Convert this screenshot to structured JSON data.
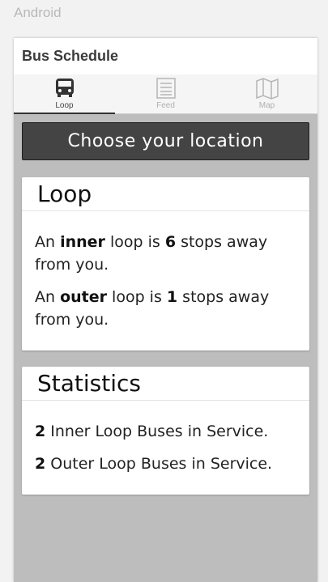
{
  "system": {
    "label": "Android"
  },
  "header": {
    "title": "Bus Schedule"
  },
  "tabs": [
    {
      "label": "Loop",
      "icon": "bus-icon",
      "active": true
    },
    {
      "label": "Feed",
      "icon": "list-icon",
      "active": false
    },
    {
      "label": "Map",
      "icon": "map-icon",
      "active": false
    }
  ],
  "location_button": {
    "label": "Choose your location"
  },
  "loop_card": {
    "title": "Loop",
    "inner": {
      "prefix": "An ",
      "kind": "inner",
      "mid": " loop is ",
      "count": "6",
      "suffix": " stops away from you."
    },
    "outer": {
      "prefix": "An ",
      "kind": "outer",
      "mid": " loop is ",
      "count": "1",
      "suffix": " stops away from you."
    }
  },
  "stats_card": {
    "title": "Statistics",
    "inner": {
      "count": "2",
      "text": " Inner Loop Buses in Service."
    },
    "outer": {
      "count": "2",
      "text": " Outer Loop Buses in Service."
    }
  },
  "colors": {
    "button_bg": "#444444",
    "app_bg": "#bdbdbd",
    "card_bg": "#ffffff"
  }
}
